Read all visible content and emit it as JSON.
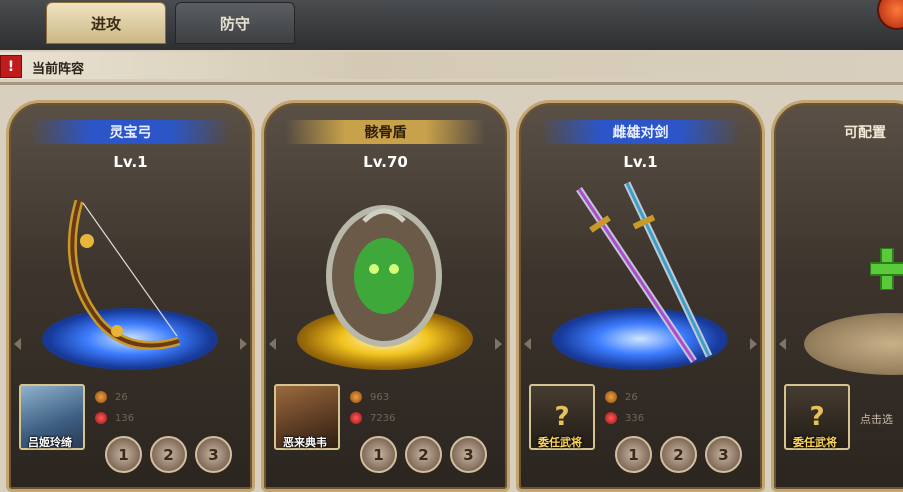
{
  "tabs": [
    {
      "label": "进攻",
      "active": true
    },
    {
      "label": "防守",
      "active": false
    }
  ],
  "section": {
    "title": "当前阵容",
    "alert_icon": "!"
  },
  "cards": [
    {
      "name": "灵宝弓",
      "level": "Lv.1",
      "banner_color": "#2c56c8",
      "pad": "blue",
      "art_icon": "bow-icon",
      "hero": "吕姬玲绮",
      "stat1": "26",
      "stat2": "136",
      "slots": [
        "1",
        "2",
        "3"
      ]
    },
    {
      "name": "骸骨盾",
      "level": "Lv.70",
      "banner_color": "#c8a24a",
      "pad": "gold",
      "art_icon": "shield-icon",
      "hero": "恶来典韦",
      "stat1": "963",
      "stat2": "7236",
      "slots": [
        "1",
        "2",
        "3"
      ]
    },
    {
      "name": "雌雄对剑",
      "level": "Lv.1",
      "banner_color": "#2c56c8",
      "pad": "blue",
      "art_icon": "twin-swords-icon",
      "hero": "委任武将",
      "stat1": "26",
      "stat2": "336",
      "slots": [
        "1",
        "2",
        "3"
      ]
    },
    {
      "name": "可配置",
      "art_icon": "plus-icon",
      "hero": "委任武将",
      "hint": "点击选"
    }
  ],
  "colors": {
    "accent_gold": "#c2a671",
    "alert_red": "#c21b1b",
    "plus_green": "#5ac93a"
  }
}
